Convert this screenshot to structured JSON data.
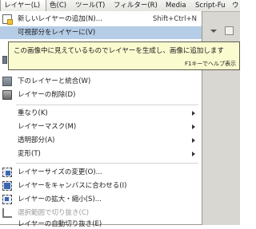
{
  "menubar": {
    "items": [
      "レイヤー(L)",
      "色(C)",
      "ツール(T)",
      "フィルター(R)",
      "Media",
      "Script-Fu",
      "ウ"
    ]
  },
  "menu": {
    "items": [
      {
        "label": "新しいレイヤーの追加(N)...",
        "accel": "Shift+Ctrl+N",
        "icon": "new-layer-icon"
      },
      {
        "label": "可視部分をレイヤーに(V)",
        "highlighted": true
      },
      {
        "label": "下のレイヤーと統合(W)",
        "icon": "merge-down-icon"
      },
      {
        "label": "レイヤーの削除(D)",
        "icon": "delete-icon"
      },
      {
        "label": "重なり(K)",
        "submenu": true
      },
      {
        "label": "レイヤーマスク(M)",
        "submenu": true
      },
      {
        "label": "透明部分(A)",
        "submenu": true
      },
      {
        "label": "変形(T)",
        "submenu": true
      },
      {
        "label": "レイヤーサイズの変更(O)...",
        "icon": "layer-boundary-icon"
      },
      {
        "label": "レイヤーをキャンバスに合わせる(I)",
        "icon": "layer-to-image-size-icon"
      },
      {
        "label": "レイヤーの拡大・縮小(S)...",
        "icon": "scale-icon"
      },
      {
        "label": "選択範囲で切り抜き(C)",
        "icon": "crop-icon",
        "disabled": true
      },
      {
        "label": "レイヤーの自動切り抜き(E)"
      }
    ]
  },
  "tooltip": {
    "text": "この画像中に見えているものでレイヤーを生成し、画像に追加します",
    "help": "F1キーでヘルプ表示"
  }
}
